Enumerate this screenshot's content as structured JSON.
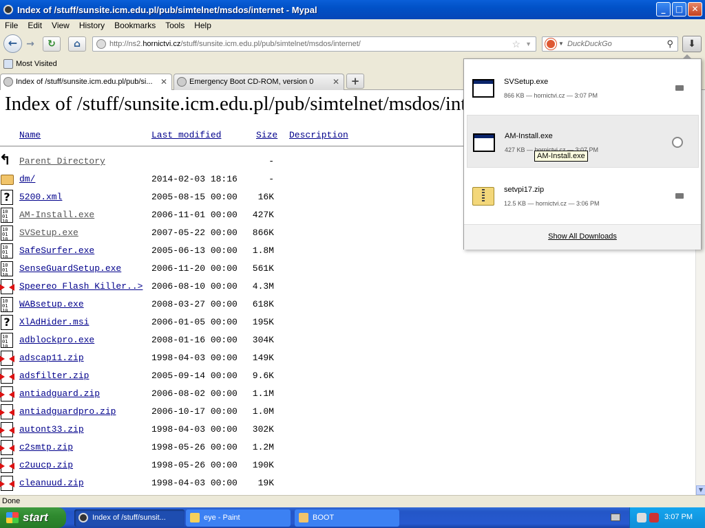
{
  "window": {
    "title": "Index of /stuff/sunsite.icm.edu.pl/pub/simtelnet/msdos/internet - Mypal",
    "buttons": {
      "minimize": "_",
      "maximize": "□",
      "close": "✕"
    }
  },
  "menu": [
    "File",
    "Edit",
    "View",
    "History",
    "Bookmarks",
    "Tools",
    "Help"
  ],
  "nav": {
    "url_prefix": "http://ns2.",
    "url_domain": "hornictvi.cz",
    "url_suffix": "/stuff/sunsite.icm.edu.pl/pub/simtelnet/msdos/internet/",
    "search_placeholder": "DuckDuckGo"
  },
  "bookmarks": {
    "most_visited": "Most Visited"
  },
  "tabs": [
    {
      "label": "Index of /stuff/sunsite.icm.edu.pl/pub/si...",
      "active": true
    },
    {
      "label": "Emergency Boot CD-ROM, version 0",
      "active": false
    }
  ],
  "page": {
    "heading": "Index of /stuff/sunsite.icm.edu.pl/pub/simtelnet/msdos/internet",
    "columns": {
      "name": "Name",
      "modified": "Last modified",
      "size": "Size",
      "description": "Description"
    },
    "rows": [
      {
        "icon": "back",
        "name": "Parent Directory",
        "date": "",
        "size": "-",
        "visited": true
      },
      {
        "icon": "folder",
        "name": "dm/",
        "date": "2014-02-03 18:16",
        "size": "-",
        "visited": false
      },
      {
        "icon": "unknown",
        "name": "5200.xml",
        "date": "2005-08-15 00:00",
        "size": "16K",
        "visited": false
      },
      {
        "icon": "binary",
        "name": "AM-Install.exe",
        "date": "2006-11-01 00:00",
        "size": "427K",
        "visited": true
      },
      {
        "icon": "binary",
        "name": "SVSetup.exe",
        "date": "2007-05-22 00:00",
        "size": "866K",
        "visited": true
      },
      {
        "icon": "binary",
        "name": "SafeSurfer.exe",
        "date": "2005-06-13 00:00",
        "size": "1.8M",
        "visited": false
      },
      {
        "icon": "binary",
        "name": "SenseGuardSetup.exe",
        "date": "2006-11-20 00:00",
        "size": "561K",
        "visited": false
      },
      {
        "icon": "compressed",
        "name": "Speereo Flash Killer..>",
        "date": "2006-08-10 00:00",
        "size": "4.3M",
        "visited": false
      },
      {
        "icon": "binary",
        "name": "WABsetup.exe",
        "date": "2008-03-27 00:00",
        "size": "618K",
        "visited": false
      },
      {
        "icon": "unknown",
        "name": "XlAdHider.msi",
        "date": "2006-01-05 00:00",
        "size": "195K",
        "visited": false
      },
      {
        "icon": "binary",
        "name": "adblockpro.exe",
        "date": "2008-01-16 00:00",
        "size": "304K",
        "visited": false
      },
      {
        "icon": "compressed",
        "name": "adscap11.zip",
        "date": "1998-04-03 00:00",
        "size": "149K",
        "visited": false
      },
      {
        "icon": "compressed",
        "name": "adsfilter.zip",
        "date": "2005-09-14 00:00",
        "size": "9.6K",
        "visited": false
      },
      {
        "icon": "compressed",
        "name": "antiadguard.zip",
        "date": "2006-08-02 00:00",
        "size": "1.1M",
        "visited": false
      },
      {
        "icon": "compressed",
        "name": "antiadguardpro.zip",
        "date": "2006-10-17 00:00",
        "size": "1.0M",
        "visited": false
      },
      {
        "icon": "compressed",
        "name": "autont33.zip",
        "date": "1998-04-03 00:00",
        "size": "302K",
        "visited": false
      },
      {
        "icon": "compressed",
        "name": "c2smtp.zip",
        "date": "1998-05-26 00:00",
        "size": "1.2M",
        "visited": false
      },
      {
        "icon": "compressed",
        "name": "c2uucp.zip",
        "date": "1998-05-26 00:00",
        "size": "190K",
        "visited": false
      },
      {
        "icon": "compressed",
        "name": "cleanuud.zip",
        "date": "1998-04-03 00:00",
        "size": "19K",
        "visited": false
      }
    ]
  },
  "downloads": {
    "items": [
      {
        "icon": "exe",
        "name": "SVSetup.exe",
        "meta": "866 KB — hornictvi.cz — 3:07 PM",
        "hover": false
      },
      {
        "icon": "exe",
        "name": "AM-Install.exe",
        "meta": "427 KB — hornictvi.cz — 3:07 PM",
        "hover": true
      },
      {
        "icon": "zip",
        "name": "setvpi17.zip",
        "meta": "12.5 KB — hornictvi.cz — 3:06 PM",
        "hover": false
      }
    ],
    "show_all": "Show All Downloads",
    "tooltip": "AM-Install.exe"
  },
  "status": "Done",
  "taskbar": {
    "start": "start",
    "tasks": [
      {
        "label": "Index of /stuff/sunsit...",
        "active": true
      },
      {
        "label": "eye - Paint",
        "active": false
      },
      {
        "label": "BOOT",
        "active": false
      }
    ],
    "clock": "3:07 PM"
  }
}
